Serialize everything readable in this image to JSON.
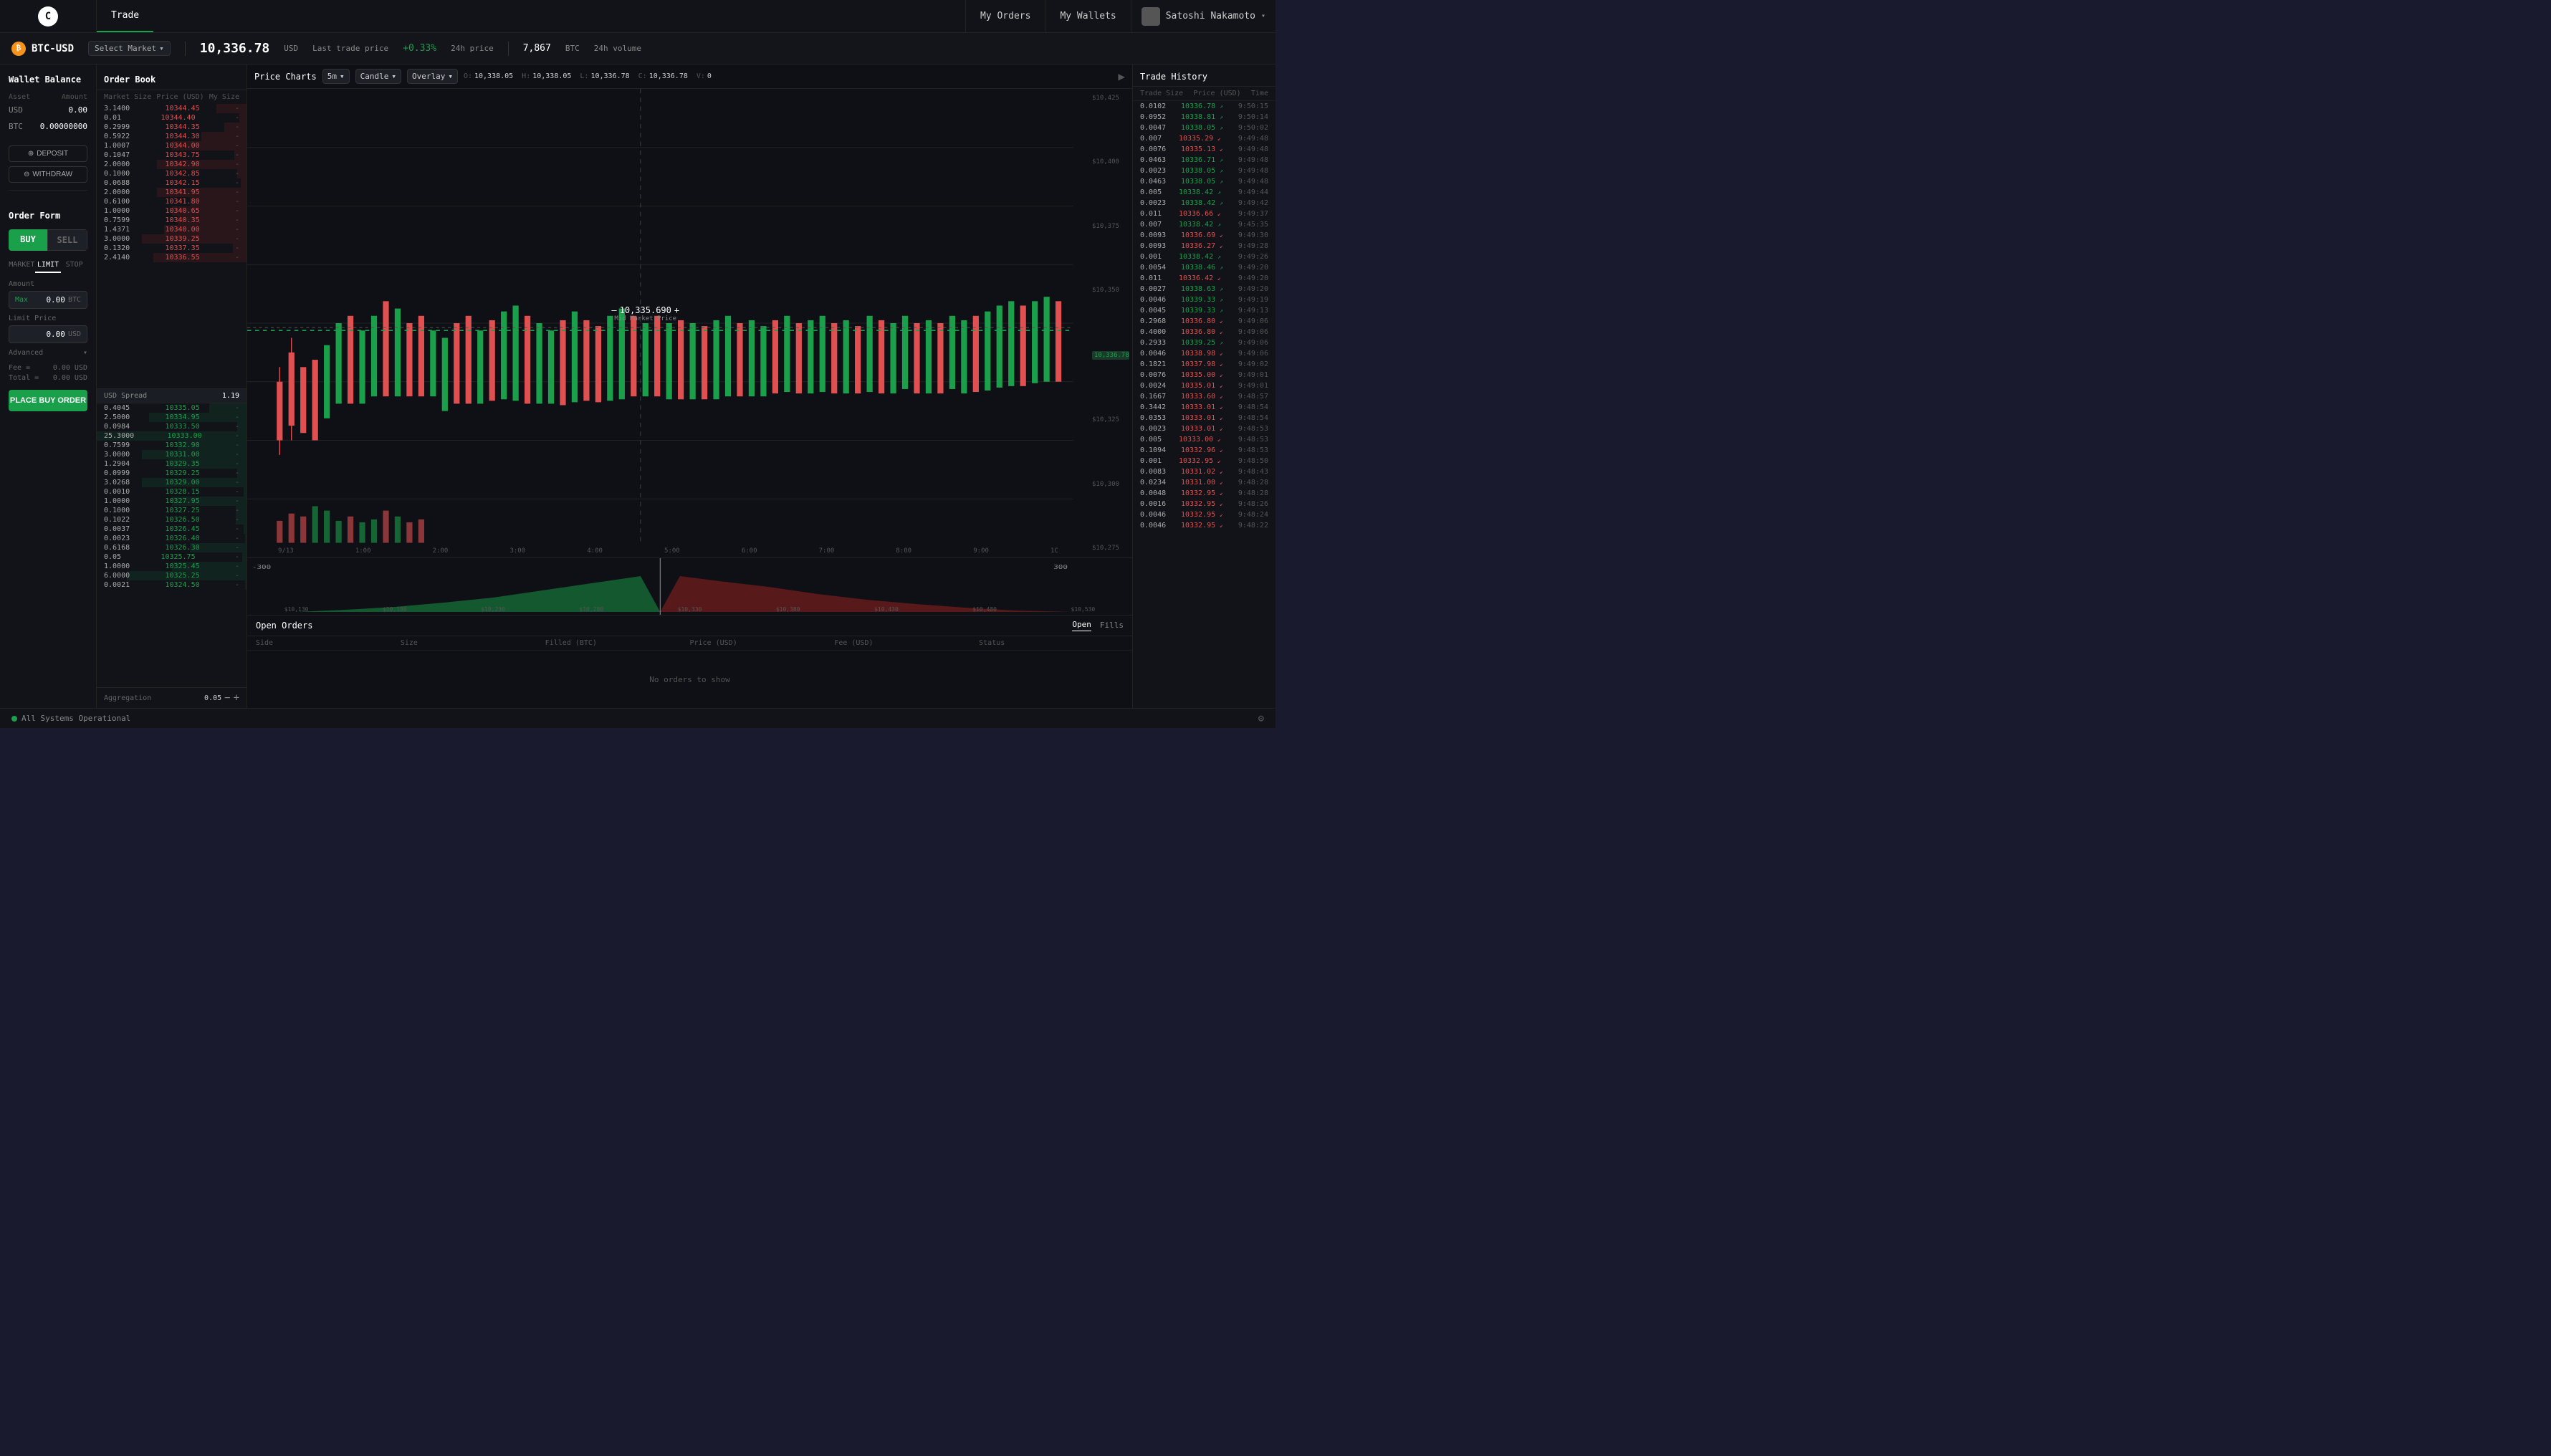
{
  "nav": {
    "logo": "C",
    "tabs": [
      {
        "label": "Trade",
        "active": true
      }
    ],
    "right_buttons": [
      "My Orders",
      "My Wallets"
    ],
    "user": {
      "name": "Satoshi Nakamoto"
    }
  },
  "ticker": {
    "pair": "BTC-USD",
    "price": "10,336.78",
    "price_unit": "USD",
    "price_label": "Last trade price",
    "change": "+0.33%",
    "change_label": "24h price",
    "volume": "7,867",
    "volume_unit": "BTC",
    "volume_label": "24h volume",
    "market_select": "Select Market"
  },
  "wallet": {
    "title": "Wallet Balance",
    "col_asset": "Asset",
    "col_amount": "Amount",
    "assets": [
      {
        "name": "USD",
        "amount": "0.00"
      },
      {
        "name": "BTC",
        "amount": "0.00000000"
      }
    ],
    "deposit_btn": "DEPOSIT",
    "withdraw_btn": "WITHDRAW"
  },
  "order_form": {
    "title": "Order Form",
    "buy_label": "BUY",
    "sell_label": "SELL",
    "types": [
      "MARKET",
      "LIMIT",
      "STOP"
    ],
    "active_type": "LIMIT",
    "amount_label": "Amount",
    "amount_value": "0.00",
    "amount_unit": "BTC",
    "amount_max": "Max",
    "limit_price_label": "Limit Price",
    "limit_price_value": "0.00",
    "limit_price_unit": "USD",
    "advanced_label": "Advanced",
    "fee_label": "Fee =",
    "fee_value": "0.00 USD",
    "total_label": "Total =",
    "total_value": "0.00 USD",
    "place_order_btn": "PLACE BUY ORDER"
  },
  "order_book": {
    "title": "Order Book",
    "cols": [
      "Market Size",
      "Price (USD)",
      "My Size"
    ],
    "asks": [
      {
        "size": "3.1400",
        "price": "10344.45",
        "my_size": "-",
        "bar_pct": 20
      },
      {
        "size": "0.01",
        "price": "10344.40",
        "my_size": "-",
        "bar_pct": 5
      },
      {
        "size": "0.2999",
        "price": "10344.35",
        "my_size": "-",
        "bar_pct": 15
      },
      {
        "size": "0.5922",
        "price": "10344.30",
        "my_size": "-",
        "bar_pct": 30
      },
      {
        "size": "1.0007",
        "price": "10344.00",
        "my_size": "-",
        "bar_pct": 50
      },
      {
        "size": "0.1047",
        "price": "10343.75",
        "my_size": "-",
        "bar_pct": 8
      },
      {
        "size": "2.0000",
        "price": "10342.90",
        "my_size": "-",
        "bar_pct": 60
      },
      {
        "size": "0.1000",
        "price": "10342.85",
        "my_size": "-",
        "bar_pct": 6
      },
      {
        "size": "0.0688",
        "price": "10342.15",
        "my_size": "-",
        "bar_pct": 4
      },
      {
        "size": "2.0000",
        "price": "10341.95",
        "my_size": "-",
        "bar_pct": 60
      },
      {
        "size": "0.6100",
        "price": "10341.80",
        "my_size": "-",
        "bar_pct": 38
      },
      {
        "size": "1.0000",
        "price": "10340.65",
        "my_size": "-",
        "bar_pct": 50
      },
      {
        "size": "0.7599",
        "price": "10340.35",
        "my_size": "-",
        "bar_pct": 46
      },
      {
        "size": "1.4371",
        "price": "10340.00",
        "my_size": "-",
        "bar_pct": 55
      },
      {
        "size": "3.0000",
        "price": "10339.25",
        "my_size": "-",
        "bar_pct": 70
      },
      {
        "size": "0.1320",
        "price": "10337.35",
        "my_size": "-",
        "bar_pct": 9
      },
      {
        "size": "2.4140",
        "price": "10336.55",
        "my_size": "-",
        "bar_pct": 62
      }
    ],
    "spread_label": "USD Spread",
    "spread_value": "1.19",
    "bids": [
      {
        "size": "0.4045",
        "price": "10335.05",
        "my_size": "-",
        "bar_pct": 25
      },
      {
        "size": "2.5000",
        "price": "10334.95",
        "my_size": "-",
        "bar_pct": 65
      },
      {
        "size": "0.0984",
        "price": "10333.50",
        "my_size": "-",
        "bar_pct": 6
      },
      {
        "size": "25.3000",
        "price": "10333.00",
        "my_size": "-",
        "bar_pct": 100
      },
      {
        "size": "0.7599",
        "price": "10332.90",
        "my_size": "-",
        "bar_pct": 46
      },
      {
        "size": "3.0000",
        "price": "10331.00",
        "my_size": "-",
        "bar_pct": 70
      },
      {
        "size": "1.2904",
        "price": "10329.35",
        "my_size": "-",
        "bar_pct": 52
      },
      {
        "size": "0.0999",
        "price": "10329.25",
        "my_size": "-",
        "bar_pct": 6
      },
      {
        "size": "3.0268",
        "price": "10329.00",
        "my_size": "-",
        "bar_pct": 70
      },
      {
        "size": "0.0010",
        "price": "10328.15",
        "my_size": "-",
        "bar_pct": 2
      },
      {
        "size": "1.0000",
        "price": "10327.95",
        "my_size": "-",
        "bar_pct": 50
      },
      {
        "size": "0.1000",
        "price": "10327.25",
        "my_size": "-",
        "bar_pct": 7
      },
      {
        "size": "0.1022",
        "price": "10326.50",
        "my_size": "-",
        "bar_pct": 7
      },
      {
        "size": "0.0037",
        "price": "10326.45",
        "my_size": "-",
        "bar_pct": 2
      },
      {
        "size": "0.0023",
        "price": "10326.40",
        "my_size": "-",
        "bar_pct": 1
      },
      {
        "size": "0.6168",
        "price": "10326.30",
        "my_size": "-",
        "bar_pct": 38
      },
      {
        "size": "0.05",
        "price": "10325.75",
        "my_size": "-",
        "bar_pct": 3
      },
      {
        "size": "1.0000",
        "price": "10325.45",
        "my_size": "-",
        "bar_pct": 50
      },
      {
        "size": "6.0000",
        "price": "10325.25",
        "my_size": "-",
        "bar_pct": 80
      },
      {
        "size": "0.0021",
        "price": "10324.50",
        "my_size": "-",
        "bar_pct": 1
      }
    ],
    "aggregation_label": "Aggregation",
    "aggregation_value": "0.05"
  },
  "price_chart": {
    "title": "Price Charts",
    "timeframe": "5m",
    "chart_type": "Candle",
    "overlay": "Overlay",
    "ohlcv": {
      "o": "10,338.05",
      "h": "10,338.05",
      "l": "10,336.78",
      "c": "10,336.78",
      "v": "0"
    },
    "y_axis": [
      "$10,425",
      "$10,400",
      "$10,375",
      "$10,350",
      "$10,325",
      "$10,300",
      "$10,275"
    ],
    "x_axis": [
      "9/13",
      "1:00",
      "2:00",
      "3:00",
      "4:00",
      "5:00",
      "6:00",
      "7:00",
      "8:00",
      "9:00",
      "1C"
    ],
    "price_line": "10,336.78",
    "depth_x_axis": [
      "$10,130",
      "$10,180",
      "$10,230",
      "$10,280",
      "$10,330",
      "$10,380",
      "$10,430",
      "$10,480",
      "$10,530"
    ],
    "depth_left_val": "-300",
    "depth_right_val": "300",
    "mid_price": "10,335.690",
    "mid_price_label": "Mid Market Price"
  },
  "open_orders": {
    "title": "Open Orders",
    "tabs": [
      {
        "label": "Open",
        "active": true
      },
      {
        "label": "Fills",
        "active": false
      }
    ],
    "cols": [
      "Side",
      "Size",
      "Filled (BTC)",
      "Price (USD)",
      "Fee (USD)",
      "Status"
    ],
    "empty_message": "No orders to show"
  },
  "trade_history": {
    "title": "Trade History",
    "cols": [
      "Trade Size",
      "Price (USD)",
      "Time"
    ],
    "rows": [
      {
        "size": "0.0102",
        "price": "10336.78",
        "dir": "up",
        "time": "9:50:15"
      },
      {
        "size": "0.0952",
        "price": "10338.81",
        "dir": "up",
        "time": "9:50:14"
      },
      {
        "size": "0.0047",
        "price": "10338.05",
        "dir": "up",
        "time": "9:50:02"
      },
      {
        "size": "0.007",
        "price": "10335.29",
        "dir": "dn",
        "time": "9:49:48"
      },
      {
        "size": "0.0076",
        "price": "10335.13",
        "dir": "dn",
        "time": "9:49:48"
      },
      {
        "size": "0.0463",
        "price": "10336.71",
        "dir": "up",
        "time": "9:49:48"
      },
      {
        "size": "0.0023",
        "price": "10338.05",
        "dir": "up",
        "time": "9:49:48"
      },
      {
        "size": "0.0463",
        "price": "10338.05",
        "dir": "up",
        "time": "9:49:48"
      },
      {
        "size": "0.005",
        "price": "10338.42",
        "dir": "up",
        "time": "9:49:44"
      },
      {
        "size": "0.0023",
        "price": "10338.42",
        "dir": "up",
        "time": "9:49:42"
      },
      {
        "size": "0.011",
        "price": "10336.66",
        "dir": "dn",
        "time": "9:49:37"
      },
      {
        "size": "0.007",
        "price": "10338.42",
        "dir": "up",
        "time": "9:45:35"
      },
      {
        "size": "0.0093",
        "price": "10336.69",
        "dir": "dn",
        "time": "9:49:30"
      },
      {
        "size": "0.0093",
        "price": "10336.27",
        "dir": "dn",
        "time": "9:49:28"
      },
      {
        "size": "0.001",
        "price": "10338.42",
        "dir": "up",
        "time": "9:49:26"
      },
      {
        "size": "0.0054",
        "price": "10338.46",
        "dir": "up",
        "time": "9:49:20"
      },
      {
        "size": "0.011",
        "price": "10336.42",
        "dir": "dn",
        "time": "9:49:20"
      },
      {
        "size": "0.0027",
        "price": "10338.63",
        "dir": "up",
        "time": "9:49:20"
      },
      {
        "size": "0.0046",
        "price": "10339.33",
        "dir": "up",
        "time": "9:49:19"
      },
      {
        "size": "0.0045",
        "price": "10339.33",
        "dir": "up",
        "time": "9:49:13"
      },
      {
        "size": "0.2968",
        "price": "10336.80",
        "dir": "dn",
        "time": "9:49:06"
      },
      {
        "size": "0.4000",
        "price": "10336.80",
        "dir": "dn",
        "time": "9:49:06"
      },
      {
        "size": "0.2933",
        "price": "10339.25",
        "dir": "up",
        "time": "9:49:06"
      },
      {
        "size": "0.0046",
        "price": "10338.98",
        "dir": "dn",
        "time": "9:49:06"
      },
      {
        "size": "0.1821",
        "price": "10337.98",
        "dir": "dn",
        "time": "9:49:02"
      },
      {
        "size": "0.0076",
        "price": "10335.00",
        "dir": "dn",
        "time": "9:49:01"
      },
      {
        "size": "0.0024",
        "price": "10335.01",
        "dir": "dn",
        "time": "9:49:01"
      },
      {
        "size": "0.1667",
        "price": "10333.60",
        "dir": "dn",
        "time": "9:48:57"
      },
      {
        "size": "0.3442",
        "price": "10333.01",
        "dir": "dn",
        "time": "9:48:54"
      },
      {
        "size": "0.0353",
        "price": "10333.01",
        "dir": "dn",
        "time": "9:48:54"
      },
      {
        "size": "0.0023",
        "price": "10333.01",
        "dir": "dn",
        "time": "9:48:53"
      },
      {
        "size": "0.005",
        "price": "10333.00",
        "dir": "dn",
        "time": "9:48:53"
      },
      {
        "size": "0.1094",
        "price": "10332.96",
        "dir": "dn",
        "time": "9:48:53"
      },
      {
        "size": "0.001",
        "price": "10332.95",
        "dir": "dn",
        "time": "9:48:50"
      },
      {
        "size": "0.0083",
        "price": "10331.02",
        "dir": "dn",
        "time": "9:48:43"
      },
      {
        "size": "0.0234",
        "price": "10331.00",
        "dir": "dn",
        "time": "9:48:28"
      },
      {
        "size": "0.0048",
        "price": "10332.95",
        "dir": "dn",
        "time": "9:48:28"
      },
      {
        "size": "0.0016",
        "price": "10332.95",
        "dir": "dn",
        "time": "9:48:26"
      },
      {
        "size": "0.0046",
        "price": "10332.95",
        "dir": "dn",
        "time": "9:48:24"
      },
      {
        "size": "0.0046",
        "price": "10332.95",
        "dir": "dn",
        "time": "9:48:22"
      }
    ]
  },
  "status_bar": {
    "status_text": "All Systems Operational",
    "settings_icon": "⚙"
  }
}
